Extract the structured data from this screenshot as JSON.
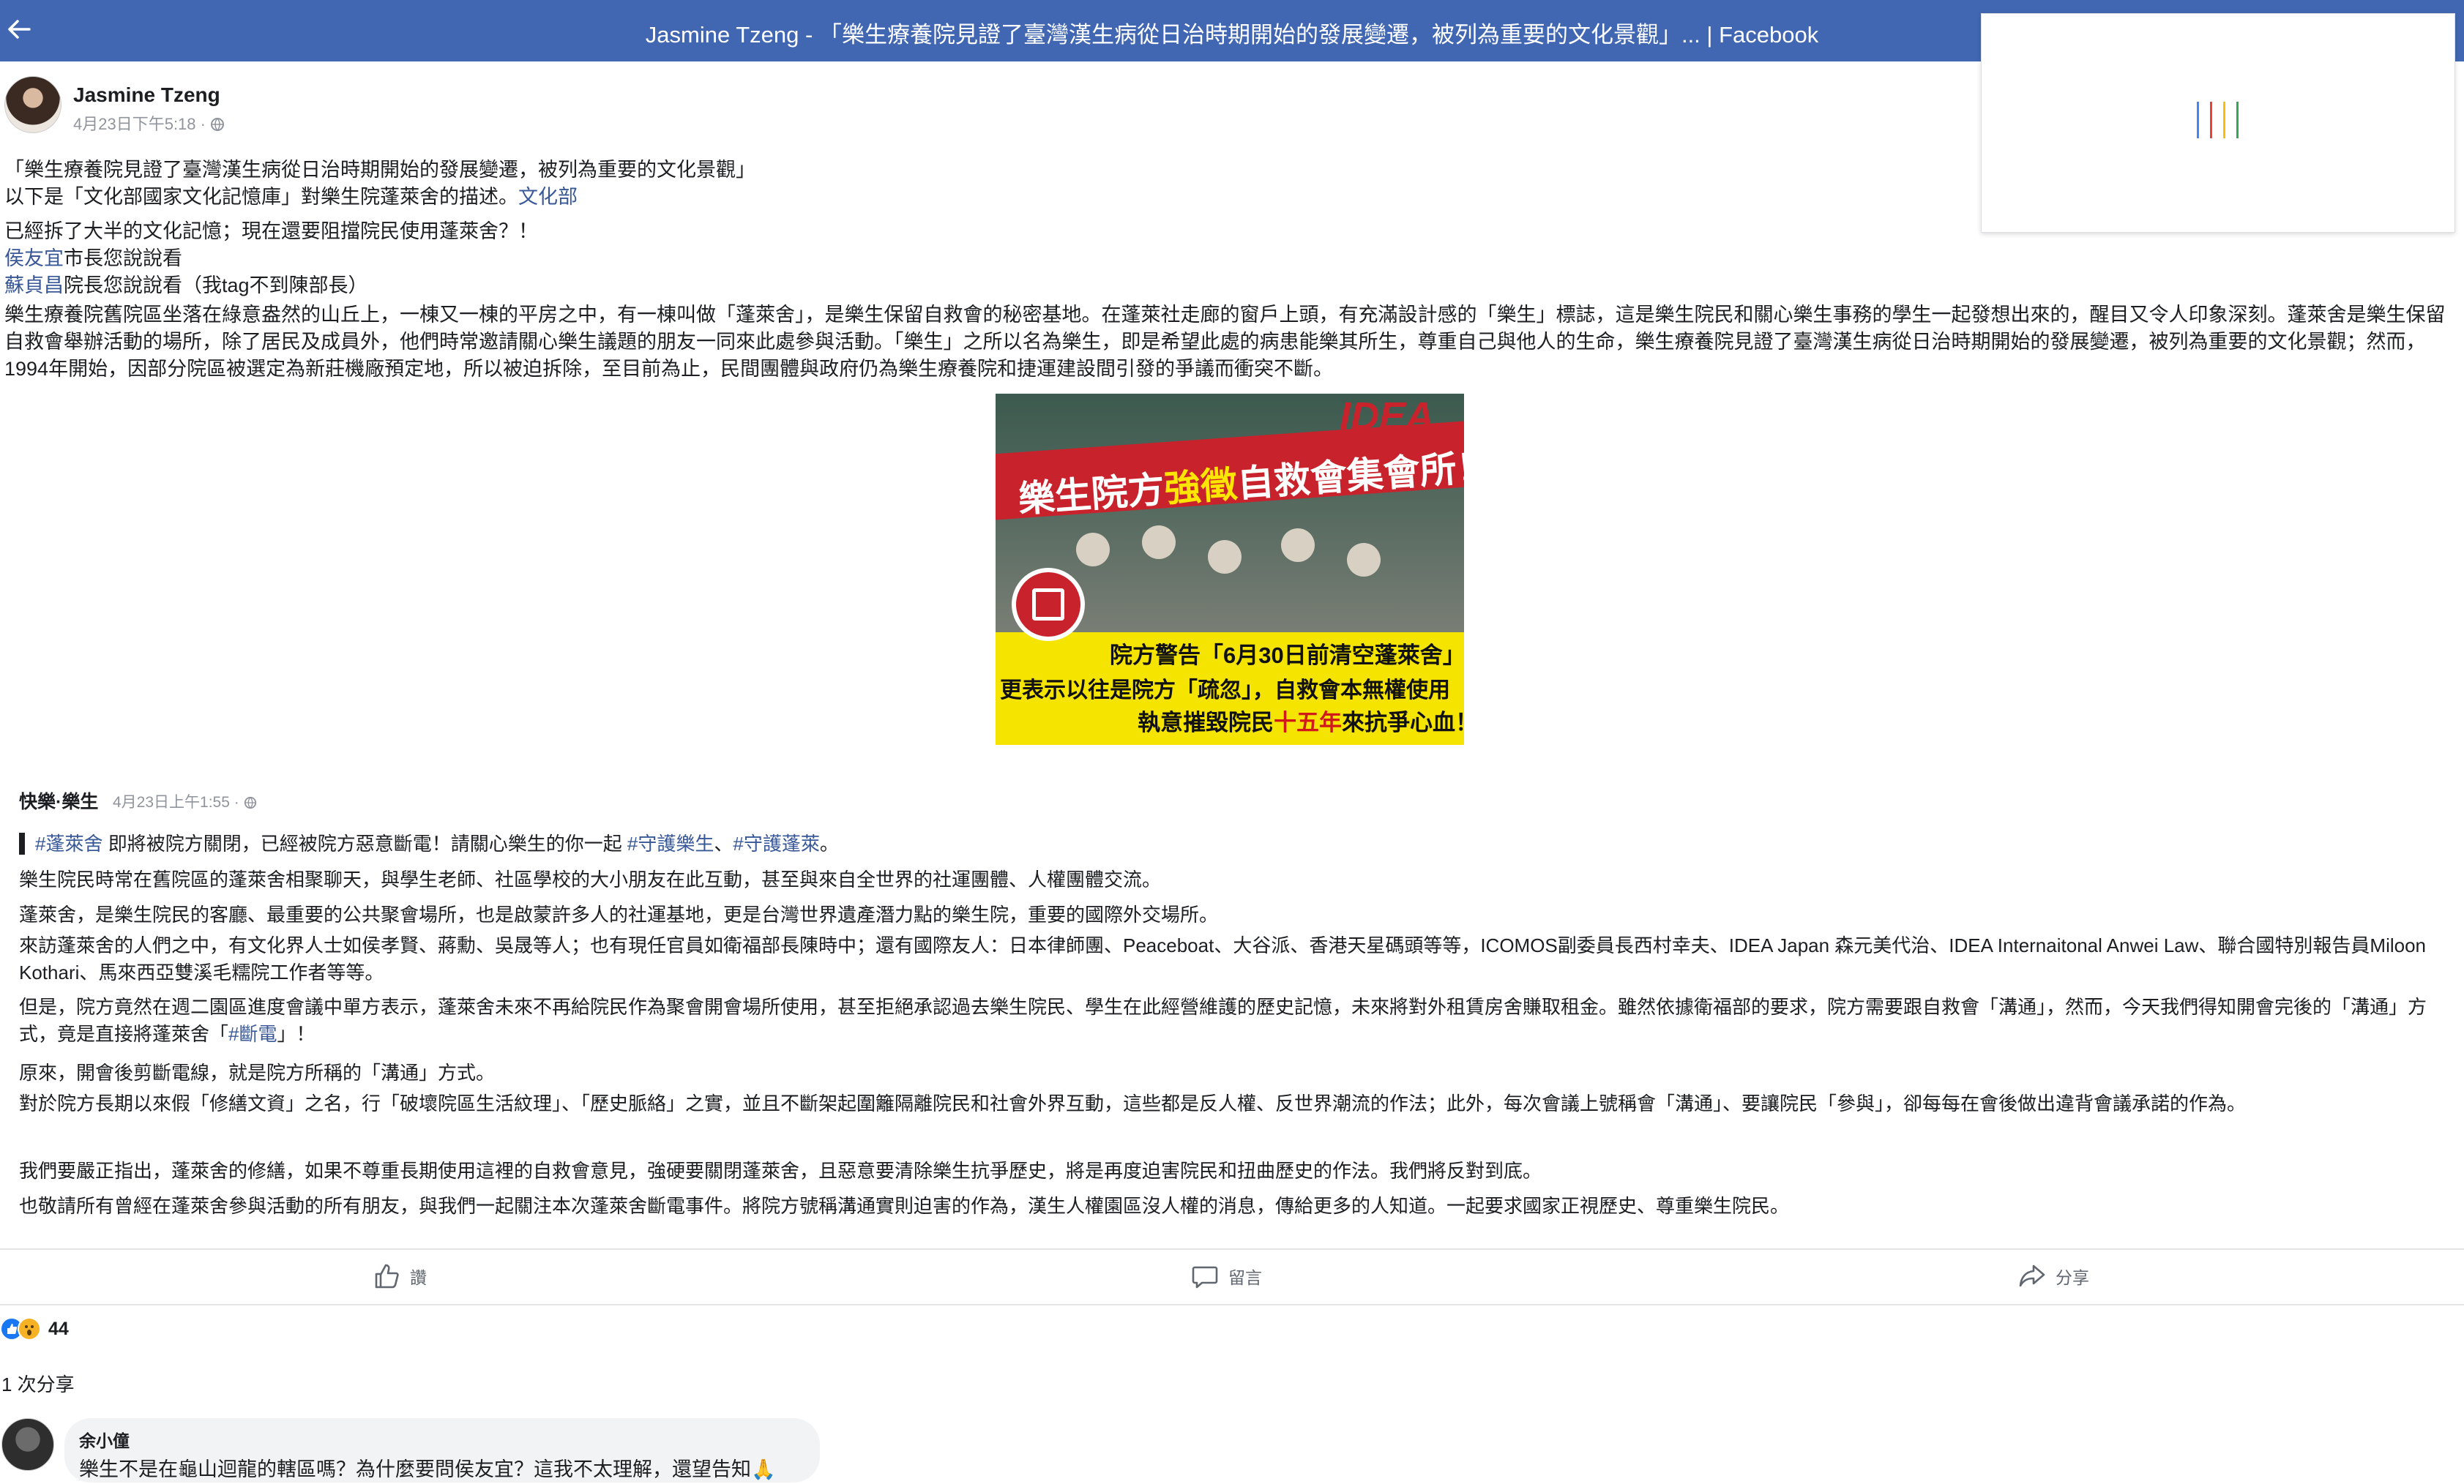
{
  "topbar": {
    "title": "Jasmine Tzeng - 「樂生療養院見證了臺灣漢生病從日治時期開始的發展變遷，被列為重要的文化景觀」... | Facebook",
    "back_icon": "back-arrow-icon",
    "color": "#4267b2"
  },
  "loader": {
    "colors": [
      "#4285f4",
      "#ea4335",
      "#fbbc05",
      "#34a853"
    ]
  },
  "post": {
    "author": "Jasmine Tzeng",
    "time": "4月23日下午5:18 · ",
    "lines": {
      "l1": "「樂生療養院見證了臺灣漢生病從日治時期開始的發展變遷，被列為重要的文化景觀」",
      "l2_pre": "以下是「文化部國家文化記憶庫」對樂生院蓬萊舍的描述。",
      "l2_link": "文化部",
      "l3": "已經拆了大半的文化記憶；現在還要阻擋院民使用蓬萊舍？！",
      "l4_link": "侯友宜",
      "l4_post": "市長您說說看",
      "l5_link": "蘇貞昌",
      "l5_post": "院長您說說看（我tag不到陳部長）"
    },
    "description": "樂生療養院舊院區坐落在綠意盎然的山丘上，一棟又一棟的平房之中，有一棟叫做「蓬萊舍」，是樂生保留自救會的秘密基地。在蓬萊社走廊的窗戶上頭，有充滿設計感的「樂生」標誌，這是樂生院民和關心樂生事務的學生一起發想出來的，醒目又令人印象深刻。蓬萊舍是樂生保留自救會舉辦活動的場所，除了居民及成員外，他們時常邀請關心樂生議題的朋友一同來此處參與活動。「樂生」之所以名為樂生，即是希望此處的病患能樂其所生，尊重自己與他人的生命，樂生療養院見證了臺灣漢生病從日治時期開始的發展變遷，被列為重要的文化景觀；然而，1994年開始，因部分院區被選定為新莊機廠預定地，所以被迫拆除，至目前為止，民間團體與政府仍為樂生療養院和捷運建設間引發的爭議而衝突不斷。"
  },
  "image": {
    "banner_a": "樂生院方",
    "banner_b": "強徵",
    "banner_c": "自救會集會所！",
    "idea": "IDEA",
    "y1": "院方警告「6月30日前清空蓬萊舍」",
    "y2": "更表示以往是院方「疏忽」，自救會本無權使用",
    "y3_a": "執意摧毀院民",
    "y3_b": "十五年",
    "y3_c": "來抗爭心血！"
  },
  "shared": {
    "author": "快樂·樂生",
    "time": "4月23日上午1:55 · ",
    "l1_tag1": "#蓬萊舍",
    "l1_mid": " 即將被院方關閉，已經被院方惡意斷電！請關心樂生的你一起 ",
    "l1_tag2": "#守護樂生",
    "l1_sep": "、",
    "l1_tag3": "#守護蓬萊",
    "l1_end": "。",
    "p2": "樂生院民時常在舊院區的蓬萊舍相聚聊天，與學生老師、社區學校的大小朋友在此互動，甚至與來自全世界的社運團體、人權團體交流。",
    "p3": "蓬萊舍，是樂生院民的客廳、最重要的公共聚會場所，也是啟蒙許多人的社運基地，更是台灣世界遺產潛力點的樂生院，重要的國際外交場所。",
    "p4": "來訪蓬萊舍的人們之中，有文化界人士如侯孝賢、蔣勳、吳晟等人；也有現任官員如衛福部長陳時中；還有國際友人：日本律師團、Peaceboat、大谷派、香港天星碼頭等等，ICOMOS副委員長西村幸夫、IDEA Japan 森元美代治、IDEA Internaitonal Anwei Law、聯合國特別報告員Miloon Kothari、馬來西亞雙溪毛糯院工作者等等。",
    "p5_pre": "但是，院方竟然在週二園區進度會議中單方表示，蓬萊舍未來不再給院民作為聚會開會場所使用，甚至拒絕承認過去樂生院民、學生在此經營維護的歷史記憶，未來將對外租賃房舍賺取租金。雖然依據衛福部的要求，院方需要跟自救會「溝通」，然而，今天我們得知開會完後的「溝通」方式，竟是直接將蓬萊舍「",
    "p5_tag": "#斷電",
    "p5_post": "」！",
    "p6": "原來，開會後剪斷電線，就是院方所稱的「溝通」方式。",
    "p7": "對於院方長期以來假「修繕文資」之名，行「破壞院區生活紋理」、「歷史脈絡」之實，並且不斷架起圍籬隔離院民和社會外界互動，這些都是反人權、反世界潮流的作法；此外，每次會議上號稱會「溝通」、要讓院民「參與」，卻每每在會後做出違背會議承諾的作為。",
    "p8": "我們要嚴正指出，蓬萊舍的修繕，如果不尊重長期使用這裡的自救會意見，強硬要關閉蓬萊舍，且惡意要清除樂生抗爭歷史，將是再度迫害院民和扭曲歷史的作法。我們將反對到底。",
    "p9": "也敬請所有曾經在蓬萊舍參與活動的所有朋友，與我們一起關注本次蓬萊舍斷電事件。將院方號稱溝通實則迫害的作為，漢生人權園區沒人權的消息，傳給更多的人知道。一起要求國家正視歷史、尊重樂生院民。"
  },
  "actions": {
    "like": "讚",
    "comment": "留言",
    "share": "分享"
  },
  "reactions": {
    "count": "44"
  },
  "share_count": "1 次分享",
  "comment": {
    "name": "余小僮",
    "text": "樂生不是在龜山迴龍的轄區嗎？為什麼要問侯友宜？這我不太理解，還望告知🙏"
  }
}
